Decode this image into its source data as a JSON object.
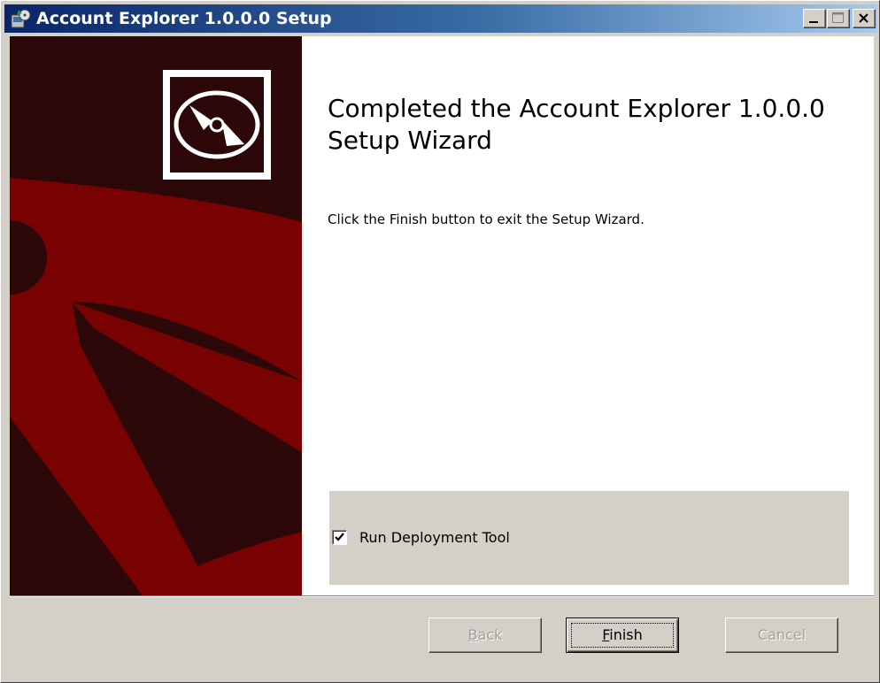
{
  "window": {
    "title": "Account Explorer 1.0.0.0 Setup",
    "title_icon": "setup-installer-icon",
    "controls": [
      "minimize-icon",
      "maximize-icon",
      "close-icon"
    ]
  },
  "banner": {
    "logo_icon": "cd-disc-icon",
    "colors": {
      "dark": "#2a0606",
      "red": "#7a0404"
    }
  },
  "content": {
    "heading": "Completed the Account Explorer 1.0.0.0 Setup Wizard",
    "description": "Click the Finish button to exit the Setup Wizard."
  },
  "option": {
    "checked": true,
    "label": "Run Deployment Tool"
  },
  "buttons": {
    "back": {
      "label": "Back",
      "mnemonic": "B",
      "enabled": false
    },
    "finish": {
      "label": "Finish",
      "mnemonic": "F",
      "enabled": true,
      "default": true
    },
    "cancel": {
      "label": "Cancel",
      "enabled": false
    }
  },
  "colors": {
    "titlebar_start": "#0a246a",
    "titlebar_end": "#a6caf0",
    "face": "#d4d0c8"
  }
}
